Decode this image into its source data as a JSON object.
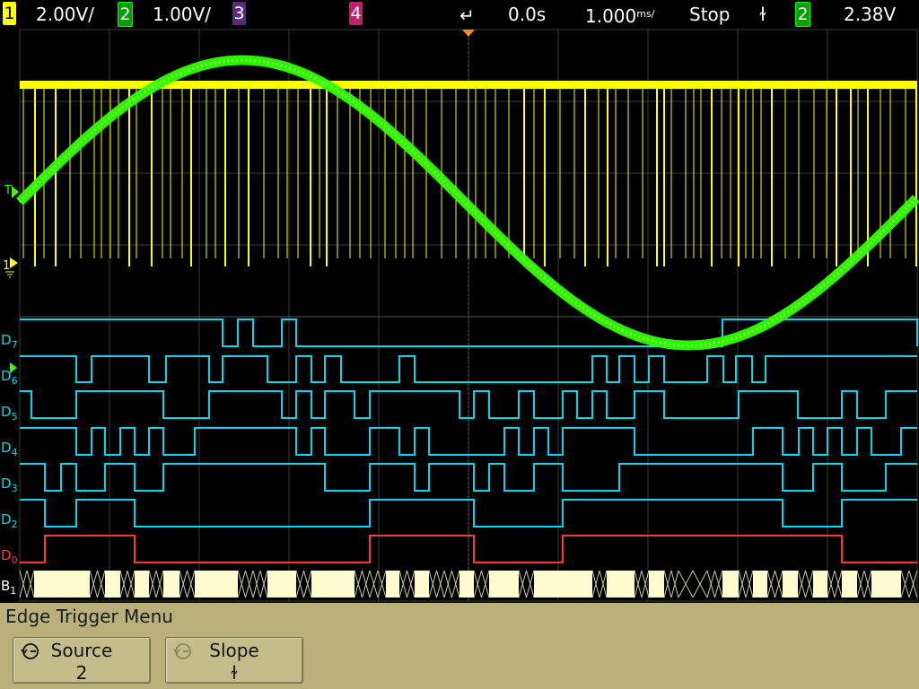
{
  "status_bar": {
    "ch1": {
      "badge": "1",
      "scale": "2.00V/",
      "color": "#ffff00"
    },
    "ch2": {
      "badge": "2",
      "scale": "1.00V/",
      "color": "#00ff00"
    },
    "ch3": {
      "badge": "3",
      "color": "#cc66ff"
    },
    "ch4": {
      "badge": "4",
      "color": "#ff3399"
    },
    "time_position": "0.0s",
    "time_base": "1.000",
    "time_base_unit": "ms/",
    "run_state": "Stop",
    "trigger_slope_symbol": "ɫ",
    "trigger_source_badge": "2",
    "trigger_level": "2.38V"
  },
  "markers": {
    "trigger_level_marker": "T",
    "ch1_ground_marker": "1",
    "bus_label": "B",
    "bus_sub": "1"
  },
  "digital_channels": [
    {
      "label": "D",
      "sub": "7",
      "color": "#00d8f0"
    },
    {
      "label": "D",
      "sub": "6",
      "color": "#00d8f0"
    },
    {
      "label": "D",
      "sub": "5",
      "color": "#00d8f0"
    },
    {
      "label": "D",
      "sub": "4",
      "color": "#00d8f0"
    },
    {
      "label": "D",
      "sub": "3",
      "color": "#00d8f0"
    },
    {
      "label": "D",
      "sub": "2",
      "color": "#00d8f0"
    },
    {
      "label": "D",
      "sub": "0",
      "color": "#ff3b30"
    }
  ],
  "menu": {
    "title": "Edge Trigger Menu",
    "softkeys": [
      {
        "label": "Source",
        "value": "2",
        "icon": "rotate-knob-icon",
        "active": true
      },
      {
        "label": "Slope",
        "value": "ɫ",
        "icon": "rotate-knob-icon",
        "active": false
      }
    ]
  },
  "colors": {
    "grid": "#3a3a3a",
    "ch1": "#ffff00",
    "ch2": "#33ff00",
    "digital": "#00d8f0",
    "bus_fill": "#fffbd0",
    "menu_bg": "#b9b07a"
  }
}
